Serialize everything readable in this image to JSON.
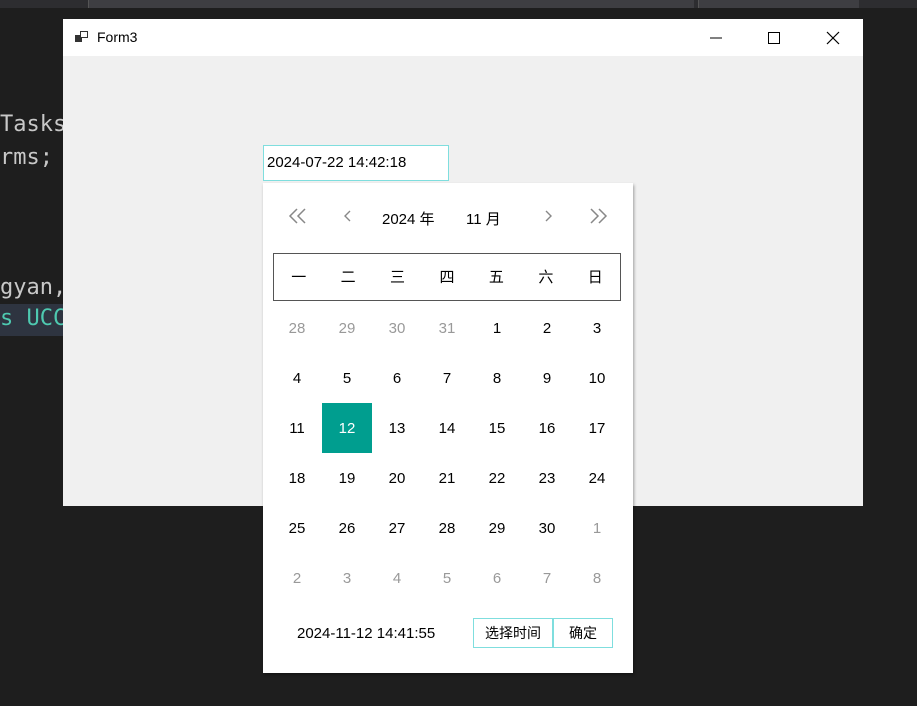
{
  "ide": {
    "code_lines": [
      "Tasks",
      "rms;",
      "gyan,",
      "s UCC"
    ]
  },
  "window": {
    "title": "Form3",
    "app_icon": "form-app-icon",
    "minimize_icon": "minimize-icon",
    "maximize_icon": "maximize-icon",
    "close_icon": "close-icon"
  },
  "date_input": {
    "value": "2024-07-22 14:42:18"
  },
  "calendar": {
    "year_label": "2024 年",
    "month_label": "11 月",
    "prev_year_icon": "double-chevron-left-icon",
    "prev_month_icon": "chevron-left-icon",
    "next_month_icon": "chevron-right-icon",
    "next_year_icon": "double-chevron-right-icon",
    "weekdays": [
      "一",
      "二",
      "三",
      "四",
      "五",
      "六",
      "日"
    ],
    "days": [
      {
        "label": "28",
        "other": true
      },
      {
        "label": "29",
        "other": true
      },
      {
        "label": "30",
        "other": true
      },
      {
        "label": "31",
        "other": true
      },
      {
        "label": "1"
      },
      {
        "label": "2"
      },
      {
        "label": "3"
      },
      {
        "label": "4"
      },
      {
        "label": "5"
      },
      {
        "label": "6"
      },
      {
        "label": "7"
      },
      {
        "label": "8"
      },
      {
        "label": "9"
      },
      {
        "label": "10"
      },
      {
        "label": "11"
      },
      {
        "label": "12",
        "selected": true
      },
      {
        "label": "13"
      },
      {
        "label": "14"
      },
      {
        "label": "15"
      },
      {
        "label": "16"
      },
      {
        "label": "17"
      },
      {
        "label": "18"
      },
      {
        "label": "19"
      },
      {
        "label": "20"
      },
      {
        "label": "21"
      },
      {
        "label": "22"
      },
      {
        "label": "23"
      },
      {
        "label": "24"
      },
      {
        "label": "25"
      },
      {
        "label": "26"
      },
      {
        "label": "27"
      },
      {
        "label": "28"
      },
      {
        "label": "29"
      },
      {
        "label": "30"
      },
      {
        "label": "1",
        "other": true
      },
      {
        "label": "2",
        "other": true
      },
      {
        "label": "3",
        "other": true
      },
      {
        "label": "4",
        "other": true
      },
      {
        "label": "5",
        "other": true
      },
      {
        "label": "6",
        "other": true
      },
      {
        "label": "7",
        "other": true
      },
      {
        "label": "8",
        "other": true
      }
    ],
    "selected_color": "#009e8f",
    "footer_time": "2024-11-12 14:41:55",
    "select_time_label": "选择时间",
    "confirm_label": "确定"
  }
}
